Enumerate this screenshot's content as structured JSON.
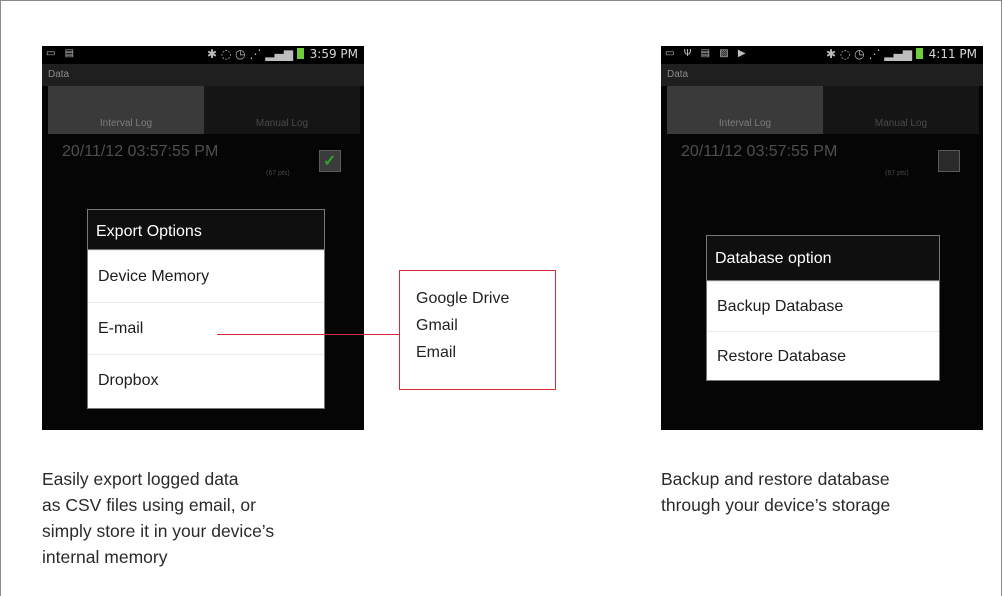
{
  "left_phone": {
    "status": {
      "time": "3:59 PM"
    },
    "app_title": "Data",
    "tabs": [
      {
        "label": "Interval Log"
      },
      {
        "label": "Manual Log"
      }
    ],
    "entry": {
      "timestamp": "20/11/12 03:57:55 PM",
      "points": "(67 pts)",
      "checked": true
    },
    "dialog": {
      "title": "Export Options",
      "items": [
        {
          "label": "Device Memory"
        },
        {
          "label": "E-mail"
        },
        {
          "label": "Dropbox"
        }
      ]
    }
  },
  "right_phone": {
    "status": {
      "time": "4:11 PM"
    },
    "app_title": "Data",
    "tabs": [
      {
        "label": "Interval Log"
      },
      {
        "label": "Manual Log"
      }
    ],
    "entry": {
      "timestamp": "20/11/12 03:57:55 PM",
      "points": "(67 pts)",
      "checked": false
    },
    "dialog": {
      "title": "Database option",
      "items": [
        {
          "label": "Backup Database"
        },
        {
          "label": "Restore Database"
        }
      ]
    }
  },
  "callout": {
    "lines": [
      "Google Drive",
      "Gmail",
      "Email"
    ],
    "accent_color": "#d42b3a"
  },
  "captions": {
    "left": [
      "Easily export logged data",
      "as CSV files using email, or",
      "simply store it in your device’s",
      "internal memory"
    ],
    "right": [
      "Backup and restore database",
      "through your device’s storage"
    ]
  },
  "colors": {
    "checkmark": "#2aa42a",
    "battery": "#6fcf3b"
  }
}
